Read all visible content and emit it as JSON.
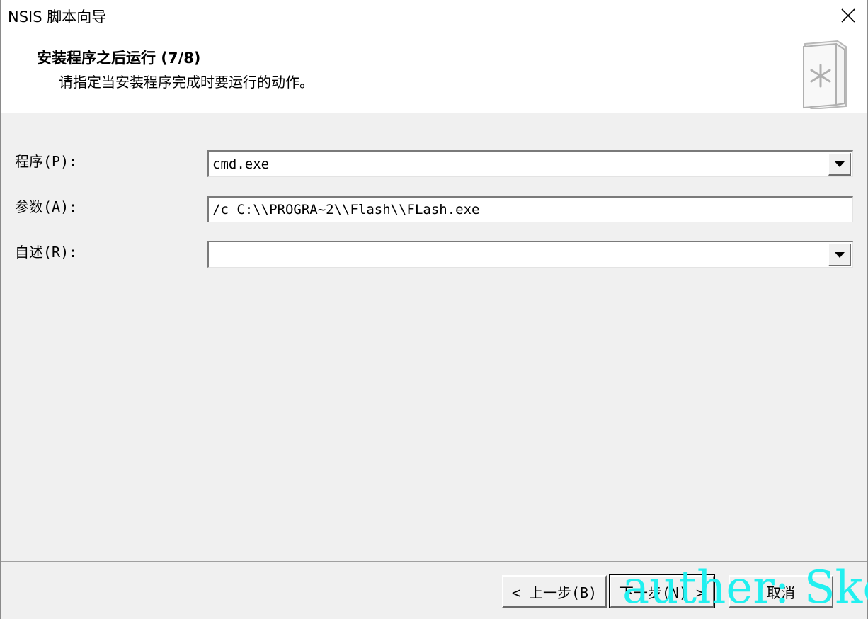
{
  "window": {
    "title": "NSIS 脚本向导"
  },
  "header": {
    "title": "安装程序之后运行 (7/8)",
    "subtitle": "请指定当安装程序完成时要运行的动作。",
    "icon": "wizard-book-icon"
  },
  "form": {
    "program_label": "程序(P):",
    "program_value": "cmd.exe",
    "params_label": "参数(A):",
    "params_value": "/c C:\\\\PROGRA~2\\\\Flash\\\\FLash.exe",
    "description_label": "自述(R):",
    "description_value": ""
  },
  "buttons": {
    "back": "< 上一步(B)",
    "next": "下一步(N) >",
    "cancel": "取消"
  },
  "watermark": "auther: Ske",
  "colors": {
    "watermark": "#22f0f0",
    "dialog_bg": "#f0f0f0",
    "header_bg": "#ffffff"
  }
}
